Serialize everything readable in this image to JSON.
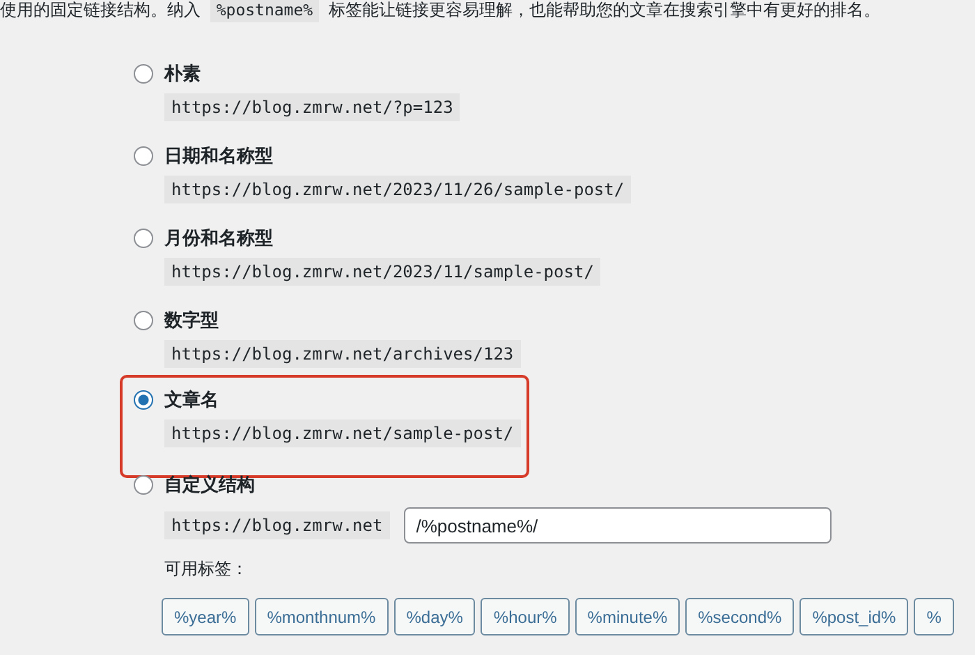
{
  "intro": "使用的固定链接结构。纳入 %postname% 标签能让链接更容易理解，也能帮助您的文章在搜索引擎中有更好的排名。",
  "options": [
    {
      "label": "朴素",
      "example": "https://blog.zmrw.net/?p=123",
      "selected": false,
      "highlighted": false
    },
    {
      "label": "日期和名称型",
      "example": "https://blog.zmrw.net/2023/11/26/sample-post/",
      "selected": false,
      "highlighted": false
    },
    {
      "label": "月份和名称型",
      "example": "https://blog.zmrw.net/2023/11/sample-post/",
      "selected": false,
      "highlighted": false
    },
    {
      "label": "数字型",
      "example": "https://blog.zmrw.net/archives/123",
      "selected": false,
      "highlighted": false
    },
    {
      "label": "文章名",
      "example": "https://blog.zmrw.net/sample-post/",
      "selected": true,
      "highlighted": true
    }
  ],
  "custom": {
    "label": "自定义结构",
    "selected": false,
    "prefix": "https://blog.zmrw.net",
    "value": "/%postname%/",
    "tags_label": "可用标签：",
    "tags": [
      "%year%",
      "%monthnum%",
      "%day%",
      "%hour%",
      "%minute%",
      "%second%",
      "%post_id%",
      "%"
    ]
  }
}
